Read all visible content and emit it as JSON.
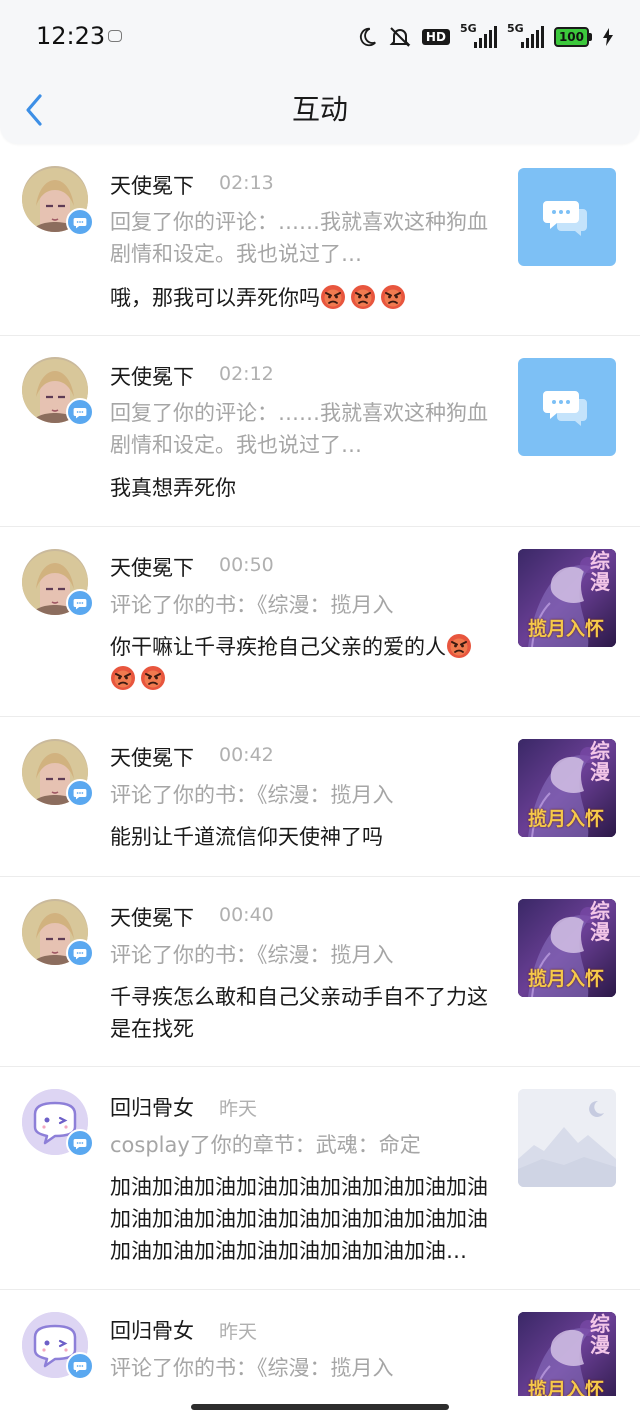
{
  "status_bar": {
    "time": "12:23",
    "hd_label": "HD",
    "network_1": "5G",
    "network_2": "5G",
    "battery": "100"
  },
  "header": {
    "title": "互动"
  },
  "items": [
    {
      "name": "天使冕下",
      "time": "02:13",
      "action": "回复了你的评论：……我就喜欢这种狗血剧情和设定。我也说过了…",
      "content": "哦，那我可以弄死你吗",
      "emoji_count": 3
    },
    {
      "name": "天使冕下",
      "time": "02:12",
      "action": "回复了你的评论：……我就喜欢这种狗血剧情和设定。我也说过了…",
      "content": "我真想弄死你"
    },
    {
      "name": "天使冕下",
      "time": "00:50",
      "action": "评论了你的书：《综漫：揽月入",
      "content": "你干嘛让千寻疾抢自己父亲的爱的人",
      "emoji_count": 3,
      "thumb_title": "揽月入怀",
      "thumb_tag": "综漫"
    },
    {
      "name": "天使冕下",
      "time": "00:42",
      "action": "评论了你的书：《综漫：揽月入",
      "content": "能别让千道流信仰天使神了吗",
      "thumb_title": "揽月入怀",
      "thumb_tag": "综漫"
    },
    {
      "name": "天使冕下",
      "time": "00:40",
      "action": "评论了你的书：《综漫：揽月入",
      "content": "千寻疾怎么敢和自己父亲动手自不了力这是在找死",
      "thumb_title": "揽月入怀",
      "thumb_tag": "综漫"
    },
    {
      "name": "回归骨女",
      "time": "昨天",
      "action": "cosplay了你的章节：武魂：命定",
      "content": "加油加油加油加油加油加油加油加油加油加油加油加油加油加油加油加油加油加油加油加油加油加油加油加油加油加油…"
    },
    {
      "name": "回归骨女",
      "time": "昨天",
      "action": "评论了你的书：《综漫：揽月入",
      "content": "",
      "thumb_title": "揽月入怀",
      "thumb_tag": "综漫"
    }
  ],
  "colors": {
    "accent_blue": "#5aa8f0",
    "thumb_blue": "#7dc0f5",
    "angry_emoji": "#e8563e"
  }
}
